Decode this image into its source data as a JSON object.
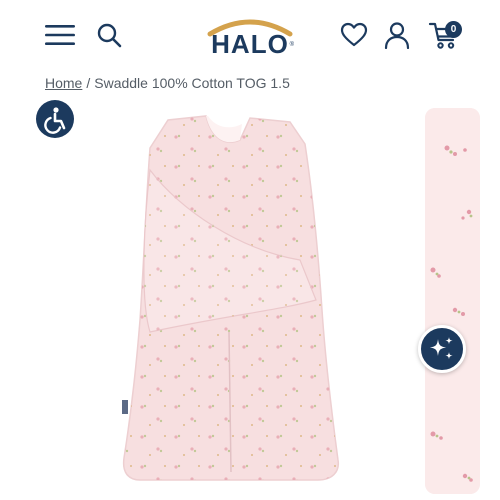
{
  "header": {
    "brand": "HALO",
    "brand_mark": "®",
    "cart_count": "0",
    "icons": [
      "menu-icon",
      "search-icon",
      "heart-icon",
      "user-icon",
      "cart-icon"
    ]
  },
  "breadcrumb": {
    "home": "Home",
    "separator": "/",
    "current": "Swaddle 100% Cotton TOG 1.5"
  },
  "floating": {
    "accessibility_icon": "accessibility-icon",
    "assistant_icon": "sparkle-icon"
  },
  "colors": {
    "brand_navy": "#1c3a5e",
    "logo_arc_gold": "#d4a24c",
    "product_pink": "#f7dfe0",
    "thumb_bg": "#fbeaea"
  }
}
